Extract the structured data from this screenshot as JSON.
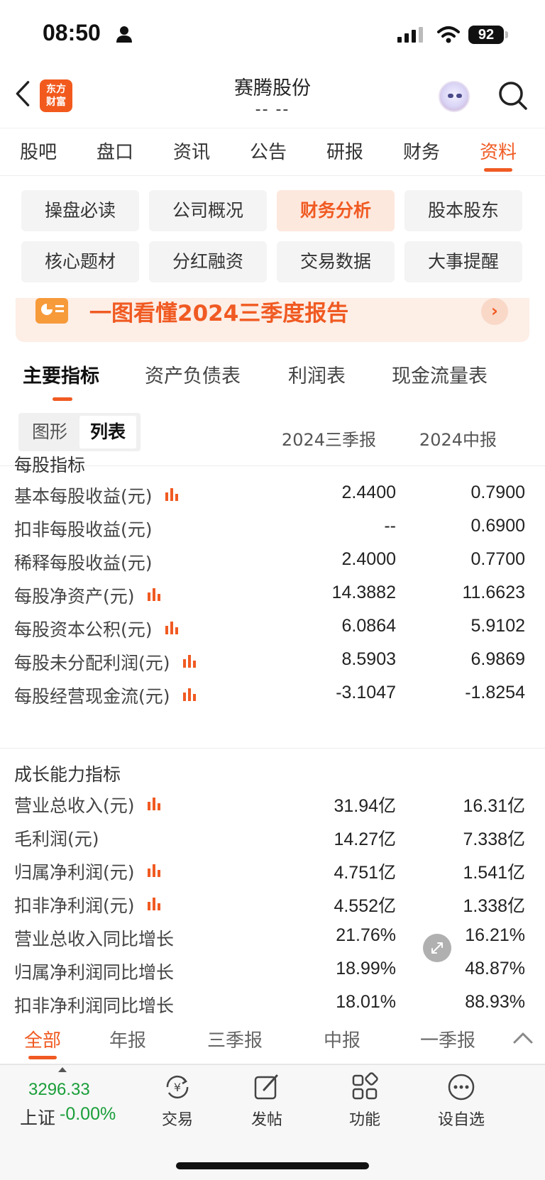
{
  "status": {
    "time": "08:50",
    "battery": "92"
  },
  "header": {
    "title": "赛腾股份",
    "subtitle": "-- --",
    "logo_text_1": "东方",
    "logo_text_2": "财富"
  },
  "main_tabs": [
    "股吧",
    "盘口",
    "资讯",
    "公告",
    "研报",
    "财务",
    "资料"
  ],
  "sub_buttons": [
    "操盘必读",
    "公司概况",
    "财务分析",
    "股本股东",
    "核心题材",
    "分红融资",
    "交易数据",
    "大事提醒"
  ],
  "banner": {
    "text": "一图看懂2024三季度报告"
  },
  "report_tabs": [
    "主要指标",
    "资产负债表",
    "利润表",
    "现金流量表"
  ],
  "view_toggle": {
    "graph": "图形",
    "list": "列表"
  },
  "periods": {
    "p1": "2024三季报",
    "p2": "2024中报"
  },
  "sections": [
    {
      "title": "每股指标",
      "rows": [
        {
          "label": "基本每股收益(元)",
          "v1": "2.4400",
          "v2": "0.7900",
          "chart": true
        },
        {
          "label": "扣非每股收益(元)",
          "v1": "--",
          "v2": "0.6900",
          "chart": false
        },
        {
          "label": "稀释每股收益(元)",
          "v1": "2.4000",
          "v2": "0.7700",
          "chart": false
        },
        {
          "label": "每股净资产(元)",
          "v1": "14.3882",
          "v2": "11.6623",
          "chart": true
        },
        {
          "label": "每股资本公积(元)",
          "v1": "6.0864",
          "v2": "5.9102",
          "chart": true
        },
        {
          "label": "每股未分配利润(元)",
          "v1": "8.5903",
          "v2": "6.9869",
          "chart": true
        },
        {
          "label": "每股经营现金流(元)",
          "v1": "-3.1047",
          "v2": "-1.8254",
          "chart": true
        }
      ]
    },
    {
      "title": "成长能力指标",
      "rows": [
        {
          "label": "营业总收入(元)",
          "v1": "31.94亿",
          "v2": "16.31亿",
          "chart": true
        },
        {
          "label": "毛利润(元)",
          "v1": "14.27亿",
          "v2": "7.338亿",
          "chart": false
        },
        {
          "label": "归属净利润(元)",
          "v1": "4.751亿",
          "v2": "1.541亿",
          "chart": true
        },
        {
          "label": "扣非净利润(元)",
          "v1": "4.552亿",
          "v2": "1.338亿",
          "chart": true
        },
        {
          "label": "营业总收入同比增长",
          "v1": "21.76%",
          "v2": "16.21%",
          "chart": false
        },
        {
          "label": "归属净利润同比增长",
          "v1": "18.99%",
          "v2": "48.87%",
          "chart": false
        },
        {
          "label": "扣非净利润同比增长",
          "v1": "18.01%",
          "v2": "88.93%",
          "chart": false
        }
      ]
    }
  ],
  "period_tabs": [
    "全部",
    "年报",
    "三季报",
    "中报",
    "一季报"
  ],
  "bottom": {
    "index_value": "3296.33",
    "index_name": "上证",
    "index_change": "-0.00%",
    "nav": [
      "交易",
      "发帖",
      "功能",
      "设自选"
    ]
  },
  "colors": {
    "accent": "#f05a22",
    "down": "#1a9e3a"
  }
}
